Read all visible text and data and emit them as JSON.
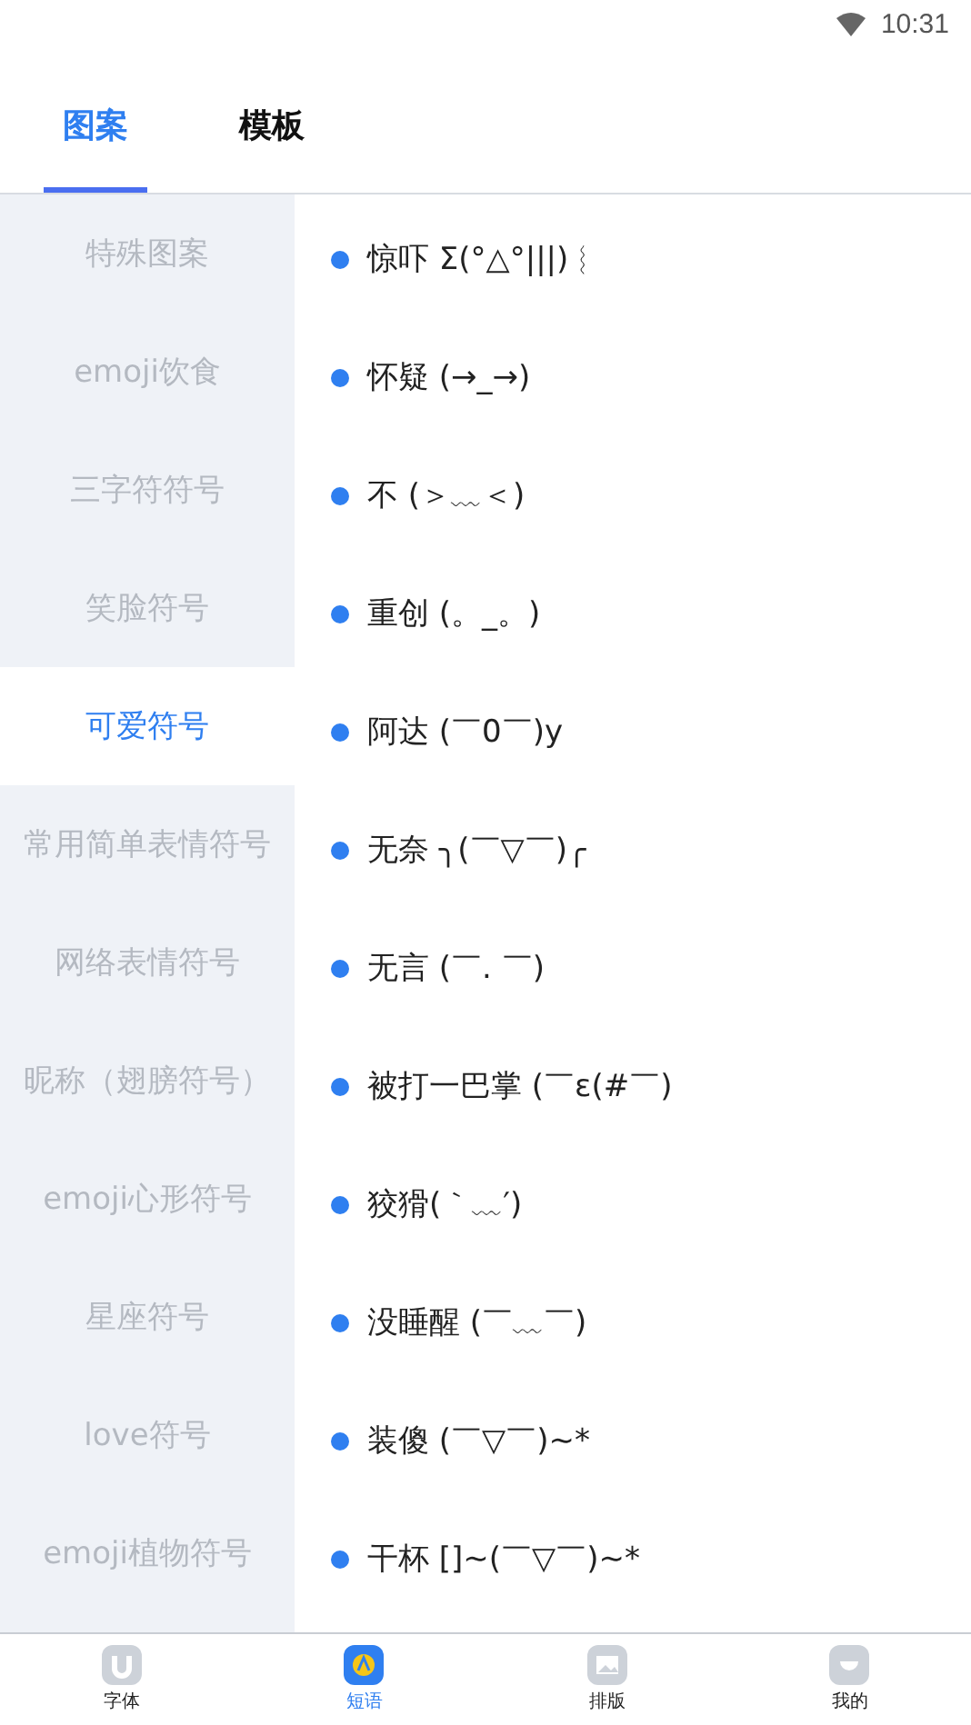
{
  "status_bar": {
    "time": "10:31"
  },
  "tabs": [
    {
      "label": "图案",
      "selected": true
    },
    {
      "label": "模板",
      "selected": false
    }
  ],
  "categories": [
    {
      "label": "特殊图案",
      "selected": false
    },
    {
      "label": "emoji饮食",
      "selected": false
    },
    {
      "label": "三字符符号",
      "selected": false
    },
    {
      "label": "笑脸符号",
      "selected": false
    },
    {
      "label": "可爱符号",
      "selected": true
    },
    {
      "label": "常用简单表情符号",
      "selected": false
    },
    {
      "label": "网络表情符号",
      "selected": false
    },
    {
      "label": "昵称（翅膀符号）",
      "selected": false
    },
    {
      "label": "emoji心形符号",
      "selected": false
    },
    {
      "label": "星座符号",
      "selected": false
    },
    {
      "label": "love符号",
      "selected": false
    },
    {
      "label": "emoji植物符号",
      "selected": false
    }
  ],
  "phrases": [
    "惊吓 Σ(°△°|||)︴",
    "怀疑 (→_→)",
    "不 (＞﹏＜)",
    "重创 (。_。)",
    "阿达 (￣0￣)y",
    "无奈 ╮(￣▽￣)╭",
    "无言 (￣. ￣)",
    "被打一巴掌 (￣ε(#￣)",
    "狡猾(｀﹏′)",
    "没睡醒 (￣﹏￣)",
    "装傻 (￣▽￣)~*",
    "干杯 []~(￣▽￣)~*"
  ],
  "bottom_nav": [
    {
      "label": "字体",
      "kind": "font",
      "selected": false
    },
    {
      "label": "短语",
      "kind": "phrase",
      "selected": true
    },
    {
      "label": "排版",
      "kind": "layout",
      "selected": false
    },
    {
      "label": "我的",
      "kind": "profile",
      "selected": false
    }
  ]
}
